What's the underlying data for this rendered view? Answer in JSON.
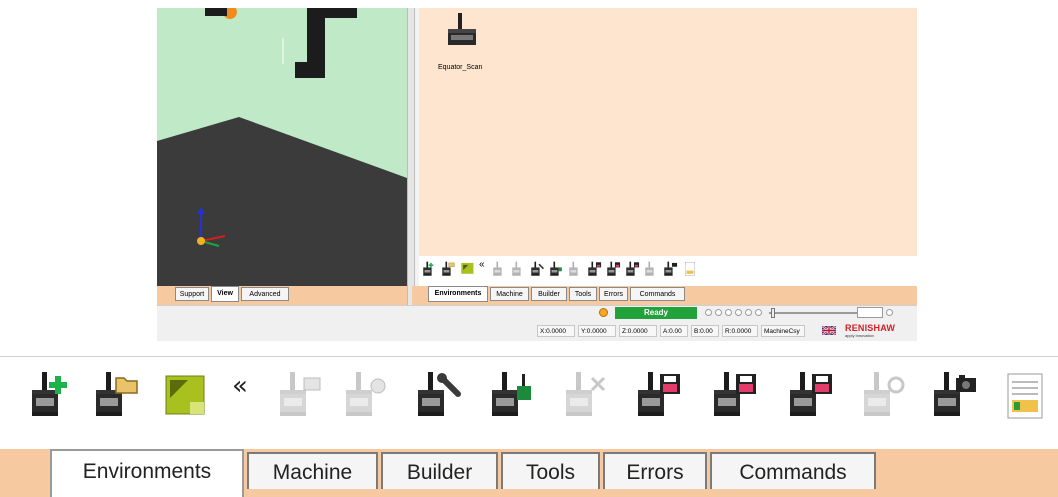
{
  "environment_item": {
    "label": "Equator_Scan",
    "icon": "cmm-scan-icon"
  },
  "left_tabs": [
    {
      "label": "Support",
      "active": false
    },
    {
      "label": "View",
      "active": true
    },
    {
      "label": "Advanced",
      "active": false
    }
  ],
  "right_tabs": [
    {
      "label": "Environments",
      "active": true
    },
    {
      "label": "Machine",
      "active": false
    },
    {
      "label": "Builder",
      "active": false
    },
    {
      "label": "Tools",
      "active": false
    },
    {
      "label": "Errors",
      "active": false
    },
    {
      "label": "Commands",
      "active": false
    }
  ],
  "toolbar": {
    "collapse_glyph": "«",
    "icons": [
      {
        "name": "new-environment-icon",
        "enabled": true
      },
      {
        "name": "open-environment-icon",
        "enabled": true
      },
      {
        "name": "resize-environment-icon",
        "enabled": true
      },
      {
        "name": "machine-list-icon",
        "enabled": false
      },
      {
        "name": "machine-check-icon",
        "enabled": false
      },
      {
        "name": "machine-tools-icon",
        "enabled": true
      },
      {
        "name": "machine-probe-icon",
        "enabled": true
      },
      {
        "name": "machine-delete-icon",
        "enabled": false
      },
      {
        "name": "machine-save-icon",
        "enabled": true
      },
      {
        "name": "machine-save-as-icon",
        "enabled": true
      },
      {
        "name": "machine-save-all-icon",
        "enabled": true
      },
      {
        "name": "machine-refresh-icon",
        "enabled": false
      },
      {
        "name": "machine-camera-icon",
        "enabled": true
      },
      {
        "name": "report-icon",
        "enabled": true
      }
    ]
  },
  "status": {
    "state": "Ready",
    "state_color": "#22a23a",
    "coords": [
      {
        "label": "X:0.0000"
      },
      {
        "label": "Y:0.0000"
      },
      {
        "label": "Z:0.0000"
      },
      {
        "label": "A:0.00"
      },
      {
        "label": "B:0.00"
      },
      {
        "label": "R:0.0000"
      },
      {
        "label": "MachineCsy"
      }
    ],
    "brand": "RENISHAW",
    "brand_tagline": "apply innovation",
    "brand_color": "#d11f26"
  },
  "colors": {
    "tab_strip": "#f7c9a0",
    "environment_panel": "#fde5cf",
    "viewport_sky": "#bfe9c7",
    "viewport_floor": "#3a3a3a"
  }
}
